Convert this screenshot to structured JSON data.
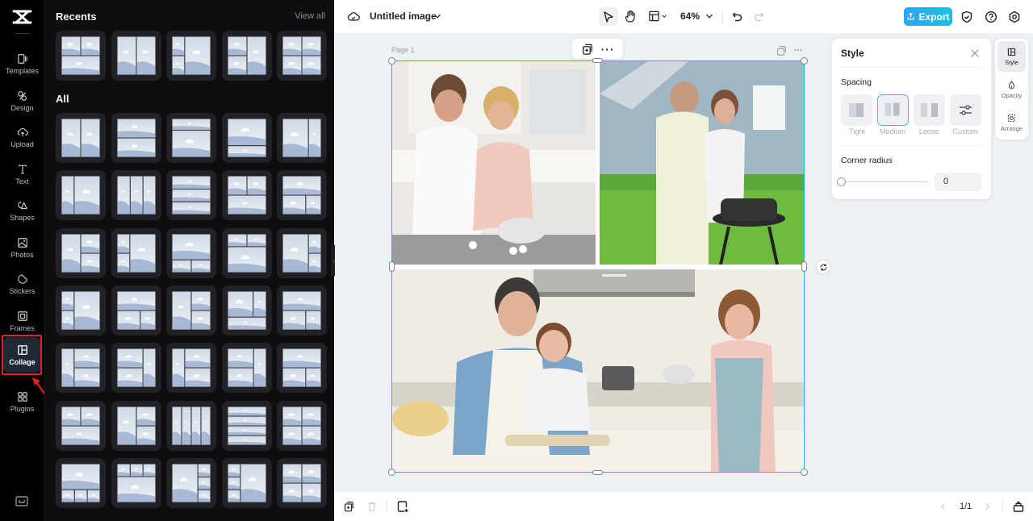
{
  "rail": {
    "items": [
      {
        "label": "Templates",
        "icon": "templates-icon"
      },
      {
        "label": "Design",
        "icon": "design-icon"
      },
      {
        "label": "Upload",
        "icon": "upload-icon"
      },
      {
        "label": "Text",
        "icon": "text-icon"
      },
      {
        "label": "Shapes",
        "icon": "shapes-icon"
      },
      {
        "label": "Photos",
        "icon": "photos-icon"
      },
      {
        "label": "Stickers",
        "icon": "stickers-icon"
      },
      {
        "label": "Frames",
        "icon": "frames-icon"
      },
      {
        "label": "Collage",
        "icon": "collage-icon",
        "active": true
      },
      {
        "label": "Plugins",
        "icon": "plugins-icon"
      }
    ]
  },
  "panel": {
    "recents_title": "Recents",
    "view_all": "View all",
    "all_title": "All",
    "recent_layouts": [
      "2top-1bottom",
      "2cols",
      "2left-1right",
      "3left-1right",
      "2x2"
    ],
    "all_layouts": [
      "2cols",
      "2rows",
      "1top-big-bottom",
      "big-top-1bottom",
      "big-left-narrow-right",
      "narrow-left-big-right",
      "3cols",
      "3rows",
      "2top-1bottom",
      "1top-2bottom",
      "big-left-2right",
      "2left-big-right",
      "1top-2bottom-b",
      "2top-big-bottom",
      "big-left-2right-b",
      "2left-big-right",
      "1top-2bottom",
      "big-left-2right",
      "2top-1bottom-b",
      "1top-2bottom",
      "narrow-left-2right",
      "2left-narrow-right",
      "narrow-left-2right",
      "2left-narrow-right",
      "1top-2bottom",
      "2top-1bottom",
      "big-left-2right",
      "4cols",
      "4rows",
      "2x2",
      "1top-3bottom",
      "3top-1bottom",
      "big-left-3right",
      "3left-big-right",
      "2x2"
    ]
  },
  "topbar": {
    "title": "Untitled image",
    "zoom": "64%",
    "export_label": "Export"
  },
  "canvas": {
    "page_label": "Page 1"
  },
  "style_panel": {
    "title": "Style",
    "spacing_label": "Spacing",
    "spacing_options": [
      "Tight",
      "Medium",
      "Loose",
      "Custom"
    ],
    "spacing_selected": "Medium",
    "corner_radius_label": "Corner radius",
    "corner_radius_value": "0"
  },
  "side_tabs": [
    {
      "label": "Style",
      "active": true
    },
    {
      "label": "Opacity"
    },
    {
      "label": "Arrange"
    }
  ],
  "bottombar": {
    "add_page": "Add page",
    "page_indicator": "1/1"
  },
  "colors": {
    "accent": "#16c1d8",
    "export_gradient_start": "#2fa3f0",
    "export_gradient_end": "#1cc2e6",
    "highlight": "#e0222a"
  }
}
